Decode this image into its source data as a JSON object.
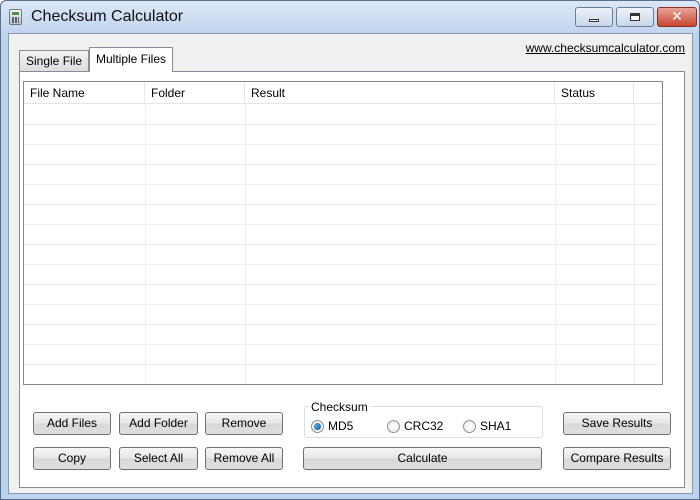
{
  "window": {
    "title": "Checksum Calculator",
    "controls": {
      "minimize": "minimize",
      "maximize": "maximize",
      "close": "✕"
    }
  },
  "link": "www.checksumcalculator.com",
  "tabs": [
    {
      "label": "Single File",
      "active": false
    },
    {
      "label": "Multiple Files",
      "active": true
    }
  ],
  "table": {
    "columns": [
      "File Name",
      "Folder",
      "Result",
      "Status",
      ""
    ],
    "rows": []
  },
  "buttons": {
    "add_files": "Add Files",
    "add_folder": "Add Folder",
    "remove": "Remove",
    "copy": "Copy",
    "select_all": "Select All",
    "remove_all": "Remove All",
    "calculate": "Calculate",
    "save_results": "Save Results",
    "compare_results": "Compare Results"
  },
  "checksum": {
    "label": "Checksum",
    "options": [
      "MD5",
      "CRC32",
      "SHA1"
    ],
    "selected": "MD5"
  },
  "colors": {
    "titlebar": "#c2d5ee",
    "radio_selected": "#0c4f8f",
    "close_button": "#c8452f"
  }
}
